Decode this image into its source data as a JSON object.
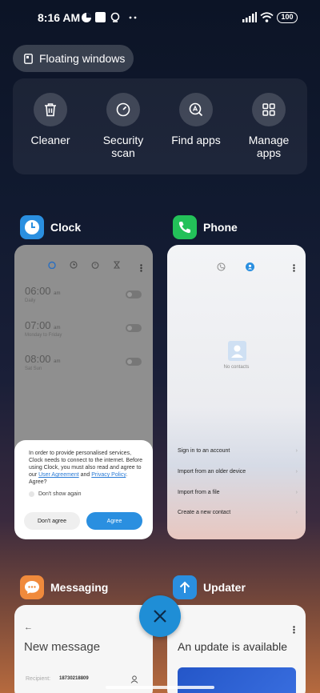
{
  "status_bar": {
    "time": "8:16 AM",
    "battery": "100"
  },
  "floating_windows": {
    "label": "Floating windows"
  },
  "quick_actions": [
    {
      "label": "Cleaner",
      "icon": "trash-icon"
    },
    {
      "label": "Security scan",
      "icon": "speedometer-icon"
    },
    {
      "label": "Find apps",
      "icon": "search-apps-icon"
    },
    {
      "label": "Manage apps",
      "icon": "grid-icon"
    }
  ],
  "apps": {
    "clock": {
      "name": "Clock",
      "color": "#2a8fe0",
      "alarms": [
        {
          "time": "06:00",
          "ampm": "am",
          "sub": "Daily"
        },
        {
          "time": "07:00",
          "ampm": "am",
          "sub": "Monday to Friday"
        },
        {
          "time": "08:00",
          "ampm": "am",
          "sub": "Sat Sun"
        }
      ],
      "dialog": {
        "text": "In order to provide personalised services, Clock needs to connect to the internet. Before using Clock, you must also read and agree to our",
        "link1": "User Agreement",
        "and": "and",
        "link2": "Privacy Policy",
        "tail": ". Agree?",
        "checkbox": "Don't show again",
        "disagree": "Don't agree",
        "agree": "Agree"
      }
    },
    "phone": {
      "name": "Phone",
      "color": "#23c159",
      "empty": "No contacts",
      "links": [
        "Sign in to an account",
        "Import from an older device",
        "Import from a file",
        "Create a new contact"
      ]
    },
    "messaging": {
      "name": "Messaging",
      "color": "#f08a3c",
      "title": "New message",
      "recipient_label": "Recipient:",
      "recipient_value": "18730218809"
    },
    "updater": {
      "name": "Updater",
      "color": "#2a8fe0",
      "title": "An update is available"
    }
  }
}
